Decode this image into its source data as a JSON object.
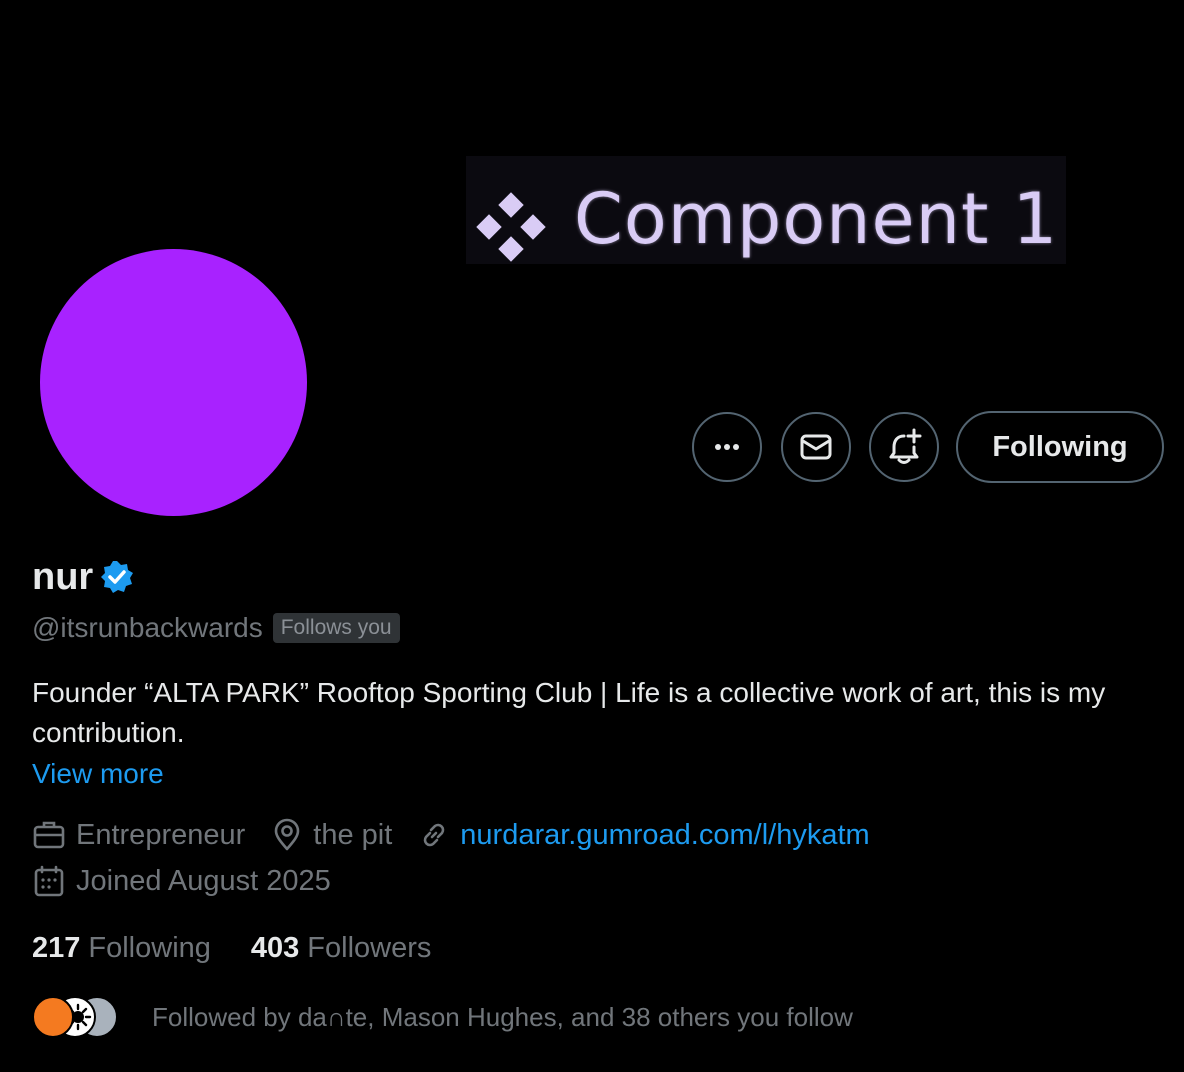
{
  "banner": {
    "text": "Component 1",
    "colors": {
      "background": "#0b0a10",
      "text": "#d9ccf5",
      "diamond": "#d9ccf5"
    }
  },
  "avatar": {
    "color": "#a822ff"
  },
  "actions": {
    "more_icon": "more-horizontal-icon",
    "message_icon": "mail-icon",
    "notify_icon": "bell-plus-icon",
    "follow_label": "Following"
  },
  "profile": {
    "name": "nur",
    "verified_icon": "verified-badge-icon",
    "handle": "@itsrunbackwards",
    "follows_you": "Follows you",
    "bio": "Founder “ALTA PARK” Rooftop Sporting Club | Life is a collective work of art, this is my contribution.",
    "view_more": "View more",
    "profession": "Entrepreneur",
    "location": "the pit",
    "website": "nurdarar.gumroad.com/l/hykatm",
    "joined": "Joined August 2025"
  },
  "stats": {
    "following_count": "217",
    "following_label": "Following",
    "followers_count": "403",
    "followers_label": "Followers"
  },
  "followed_by": {
    "text": "Followed by da∩te, Mason Hughes, and 38 others you follow",
    "avatar_colors": [
      "#f47a20",
      "#ffffff",
      "#a9b2bc"
    ]
  },
  "colors": {
    "background": "#000000",
    "primary_text": "#e7e9ea",
    "secondary_text": "#71767b",
    "accent_blue": "#1d9bf0",
    "border": "#536471"
  }
}
